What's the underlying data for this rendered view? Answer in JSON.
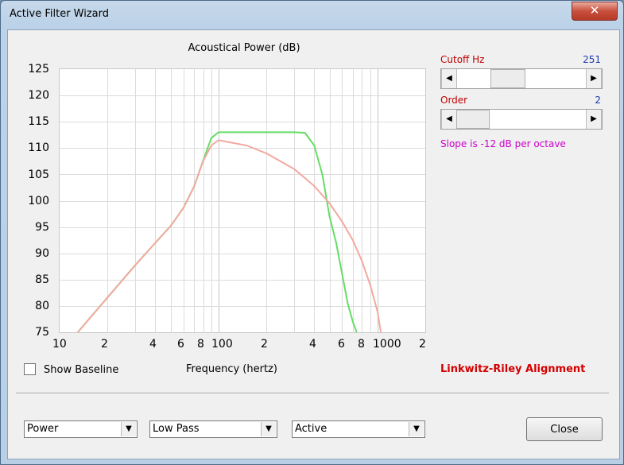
{
  "window": {
    "title": "Active Filter Wizard",
    "close_glyph": "✕"
  },
  "chart": {
    "title": "Acoustical Power (dB)",
    "ylabels": [
      "125",
      "120",
      "115",
      "110",
      "105",
      "100",
      "95",
      "90",
      "85",
      "80",
      "75"
    ],
    "xlabels": [
      "10",
      "2",
      "4",
      "6",
      "8",
      "100",
      "2",
      "4",
      "6",
      "8",
      "1000",
      "2"
    ],
    "xtitle": "Frequency (hertz)"
  },
  "chart_data": {
    "type": "line",
    "title": "Acoustical Power (dB)",
    "xlabel": "Frequency (hertz)",
    "ylabel": "",
    "xscale": "log",
    "xlim": [
      10,
      2000
    ],
    "ylim": [
      75,
      125
    ],
    "grid": true,
    "series": [
      {
        "color": "#66dd66",
        "x": [
          13,
          20,
          30,
          40,
          50,
          60,
          70,
          80,
          90,
          100,
          150,
          200,
          300,
          350,
          400,
          450,
          500,
          550,
          600,
          650,
          700,
          740
        ],
        "y": [
          75,
          81.6,
          87.8,
          92,
          95.2,
          98.6,
          102.6,
          107.6,
          111.9,
          113,
          113,
          113,
          113,
          112.9,
          110.5,
          105,
          97,
          92,
          86,
          80.5,
          77,
          75
        ]
      },
      {
        "color": "#f2a9a0",
        "x": [
          13,
          20,
          30,
          40,
          50,
          60,
          70,
          80,
          90,
          100,
          150,
          200,
          300,
          400,
          500,
          600,
          700,
          800,
          900,
          1000,
          1050
        ],
        "y": [
          75,
          81.6,
          87.8,
          92,
          95.2,
          98.6,
          102.6,
          107.5,
          110.5,
          111.5,
          110.5,
          109,
          106,
          102.8,
          99.5,
          96,
          92.5,
          88.5,
          84,
          79,
          75
        ]
      }
    ]
  },
  "controls": {
    "show_baseline_label": "Show Baseline",
    "show_baseline_checked": false,
    "alignment_label": "Linkwitz-Riley Alignment",
    "cutoff": {
      "label": "Cutoff  Hz",
      "value": "251",
      "position": 0.36
    },
    "order": {
      "label": "Order",
      "value": "2",
      "position": 0.0
    },
    "slope_text": "Slope is -12 dB per octave",
    "left_arrow": "◀",
    "right_arrow": "▶",
    "combo_arrow": "▼",
    "combo1": "Power",
    "combo2": "Low Pass",
    "combo3": "Active",
    "close_label": "Close"
  }
}
